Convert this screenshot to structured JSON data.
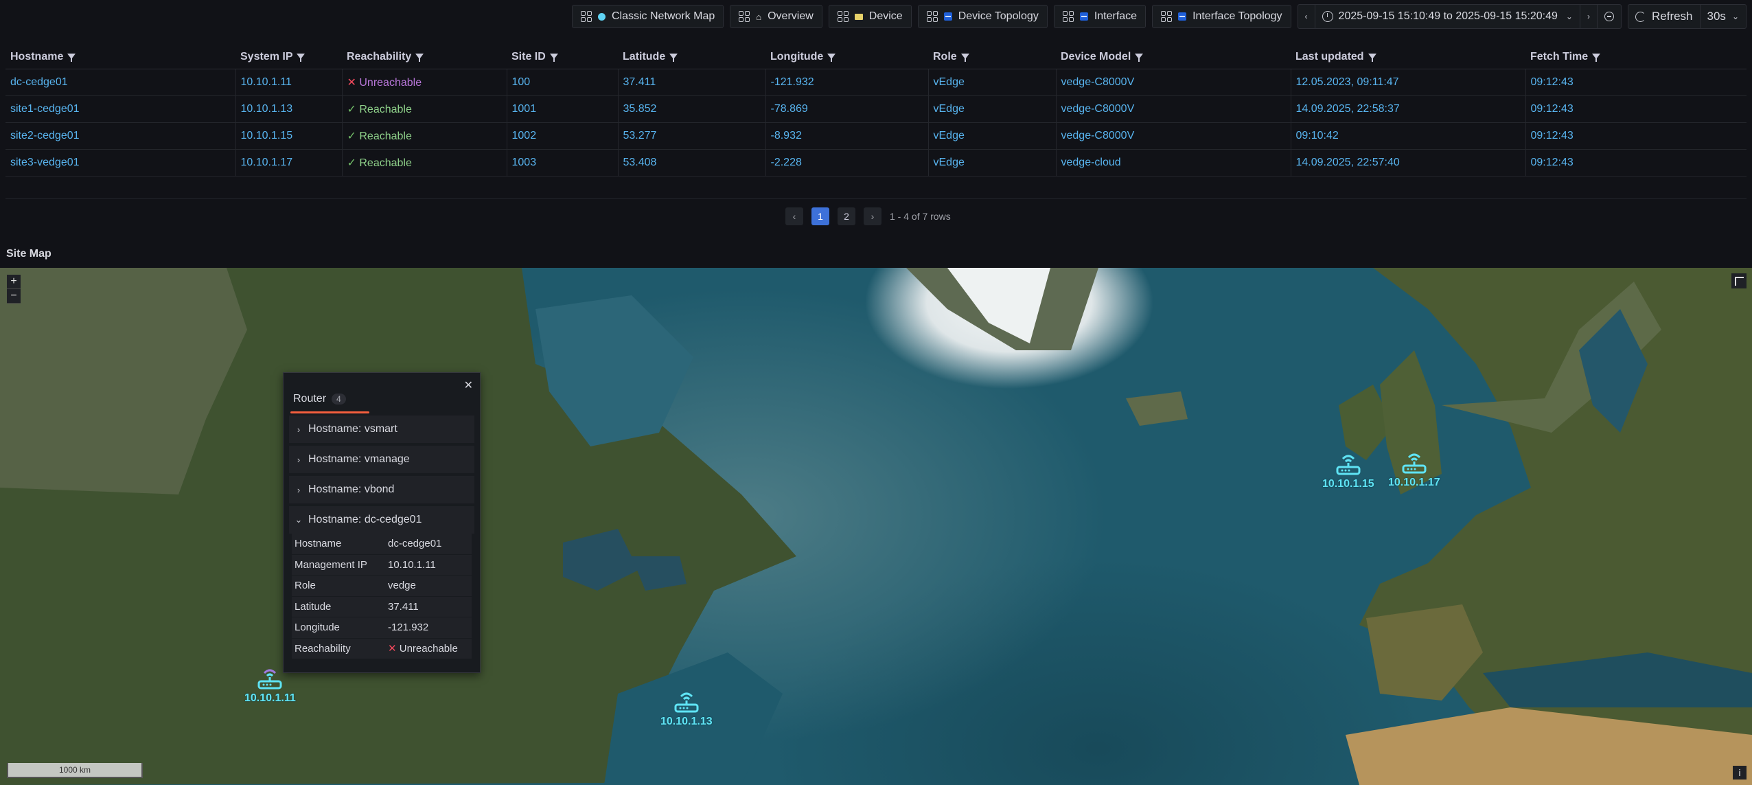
{
  "toolbar": {
    "links": [
      {
        "label": "Classic Network Map",
        "icon": "circle-icon"
      },
      {
        "label": "Overview",
        "icon": "house-icon"
      },
      {
        "label": "Device",
        "icon": "device-icon"
      },
      {
        "label": "Device Topology",
        "icon": "topology-icon"
      },
      {
        "label": "Interface",
        "icon": "topology-icon"
      },
      {
        "label": "Interface Topology",
        "icon": "topology-icon"
      }
    ],
    "time_range": "2025-09-15 15:10:49 to 2025-09-15 15:20:49",
    "refresh_label": "Refresh",
    "refresh_interval": "30s"
  },
  "table": {
    "columns": [
      "Hostname",
      "System IP",
      "Reachability",
      "Site ID",
      "Latitude",
      "Longitude",
      "Role",
      "Device Model",
      "Last updated",
      "Fetch Time"
    ],
    "rows": [
      {
        "hostname": "dc-cedge01",
        "system_ip": "10.10.1.11",
        "reachability": "Unreachable",
        "site_id": "100",
        "latitude": "37.411",
        "longitude": "-121.932",
        "role": "vEdge",
        "model": "vedge-C8000V",
        "last_updated": "12.05.2023, 09:11:47",
        "fetch_time": "09:12:43"
      },
      {
        "hostname": "site1-cedge01",
        "system_ip": "10.10.1.13",
        "reachability": "Reachable",
        "site_id": "1001",
        "latitude": "35.852",
        "longitude": "-78.869",
        "role": "vEdge",
        "model": "vedge-C8000V",
        "last_updated": "14.09.2025, 22:58:37",
        "fetch_time": "09:12:43"
      },
      {
        "hostname": "site2-cedge01",
        "system_ip": "10.10.1.15",
        "reachability": "Reachable",
        "site_id": "1002",
        "latitude": "53.277",
        "longitude": "-8.932",
        "role": "vEdge",
        "model": "vedge-C8000V",
        "last_updated": "09:10:42",
        "fetch_time": "09:12:43"
      },
      {
        "hostname": "site3-vedge01",
        "system_ip": "10.10.1.17",
        "reachability": "Reachable",
        "site_id": "1003",
        "latitude": "53.408",
        "longitude": "-2.228",
        "role": "vEdge",
        "model": "vedge-cloud",
        "last_updated": "14.09.2025, 22:57:40",
        "fetch_time": "09:12:43"
      }
    ]
  },
  "pagination": {
    "pages": [
      "1",
      "2"
    ],
    "current": "1",
    "summary": "1 - 4 of 7 rows"
  },
  "panel": {
    "title": "Site Map"
  },
  "map": {
    "zoom_in": "+",
    "zoom_out": "−",
    "scale_label": "1000 km",
    "markers": [
      {
        "ip": "10.10.1.15"
      },
      {
        "ip": "10.10.1.17"
      },
      {
        "ip": "10.10.1.11"
      },
      {
        "ip": "10.10.1.13"
      }
    ],
    "popup": {
      "tab_label": "Router",
      "tab_count": "4",
      "items": [
        "Hostname: vsmart",
        "Hostname: vmanage",
        "Hostname: vbond",
        "Hostname: dc-cedge01"
      ],
      "details": [
        {
          "key": "Hostname",
          "value": "dc-cedge01"
        },
        {
          "key": "Management IP",
          "value": "10.10.1.11"
        },
        {
          "key": "Role",
          "value": "vedge"
        },
        {
          "key": "Latitude",
          "value": "37.411"
        },
        {
          "key": "Longitude",
          "value": "-121.932"
        },
        {
          "key": "Reachability",
          "value": "Unreachable"
        }
      ]
    }
  },
  "colors": {
    "link": "#58b4ef",
    "ok": "#73bf69",
    "bad": "#f2495c",
    "marker": "#5fe4f5",
    "accent": "#3d71d9"
  }
}
